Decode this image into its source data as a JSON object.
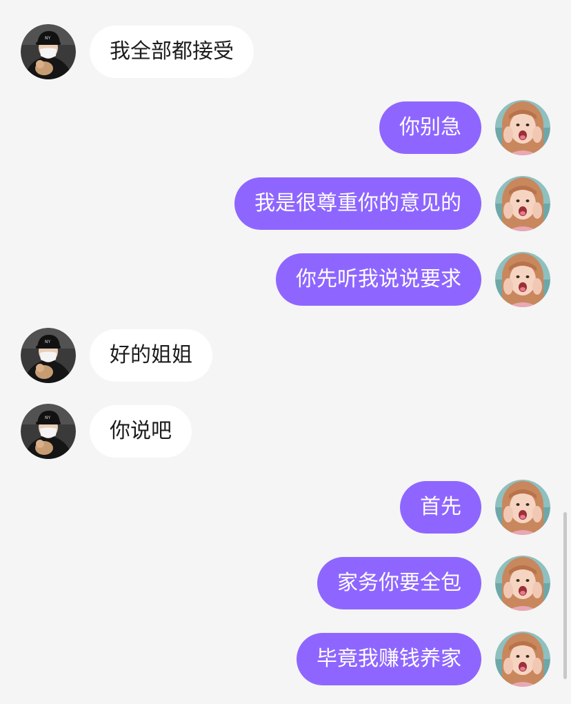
{
  "messages": [
    {
      "side": "left",
      "avatar": "male-avatar",
      "text": "我全部都接受"
    },
    {
      "side": "right",
      "avatar": "female-avatar",
      "text": "你别急"
    },
    {
      "side": "right",
      "avatar": "female-avatar",
      "text": "我是很尊重你的意见的"
    },
    {
      "side": "right",
      "avatar": "female-avatar",
      "text": "你先听我说说要求"
    },
    {
      "side": "left",
      "avatar": "male-avatar",
      "text": "好的姐姐"
    },
    {
      "side": "left",
      "avatar": "male-avatar",
      "text": "你说吧"
    },
    {
      "side": "right",
      "avatar": "female-avatar",
      "text": "首先"
    },
    {
      "side": "right",
      "avatar": "female-avatar",
      "text": "家务你要全包"
    },
    {
      "side": "right",
      "avatar": "female-avatar",
      "text": "毕竟我赚钱养家"
    }
  ],
  "colors": {
    "background": "#f5f5f5",
    "sent_bubble": "#8e66ff",
    "received_bubble": "#ffffff",
    "sent_text": "#ffffff",
    "received_text": "#1c1c1c"
  }
}
